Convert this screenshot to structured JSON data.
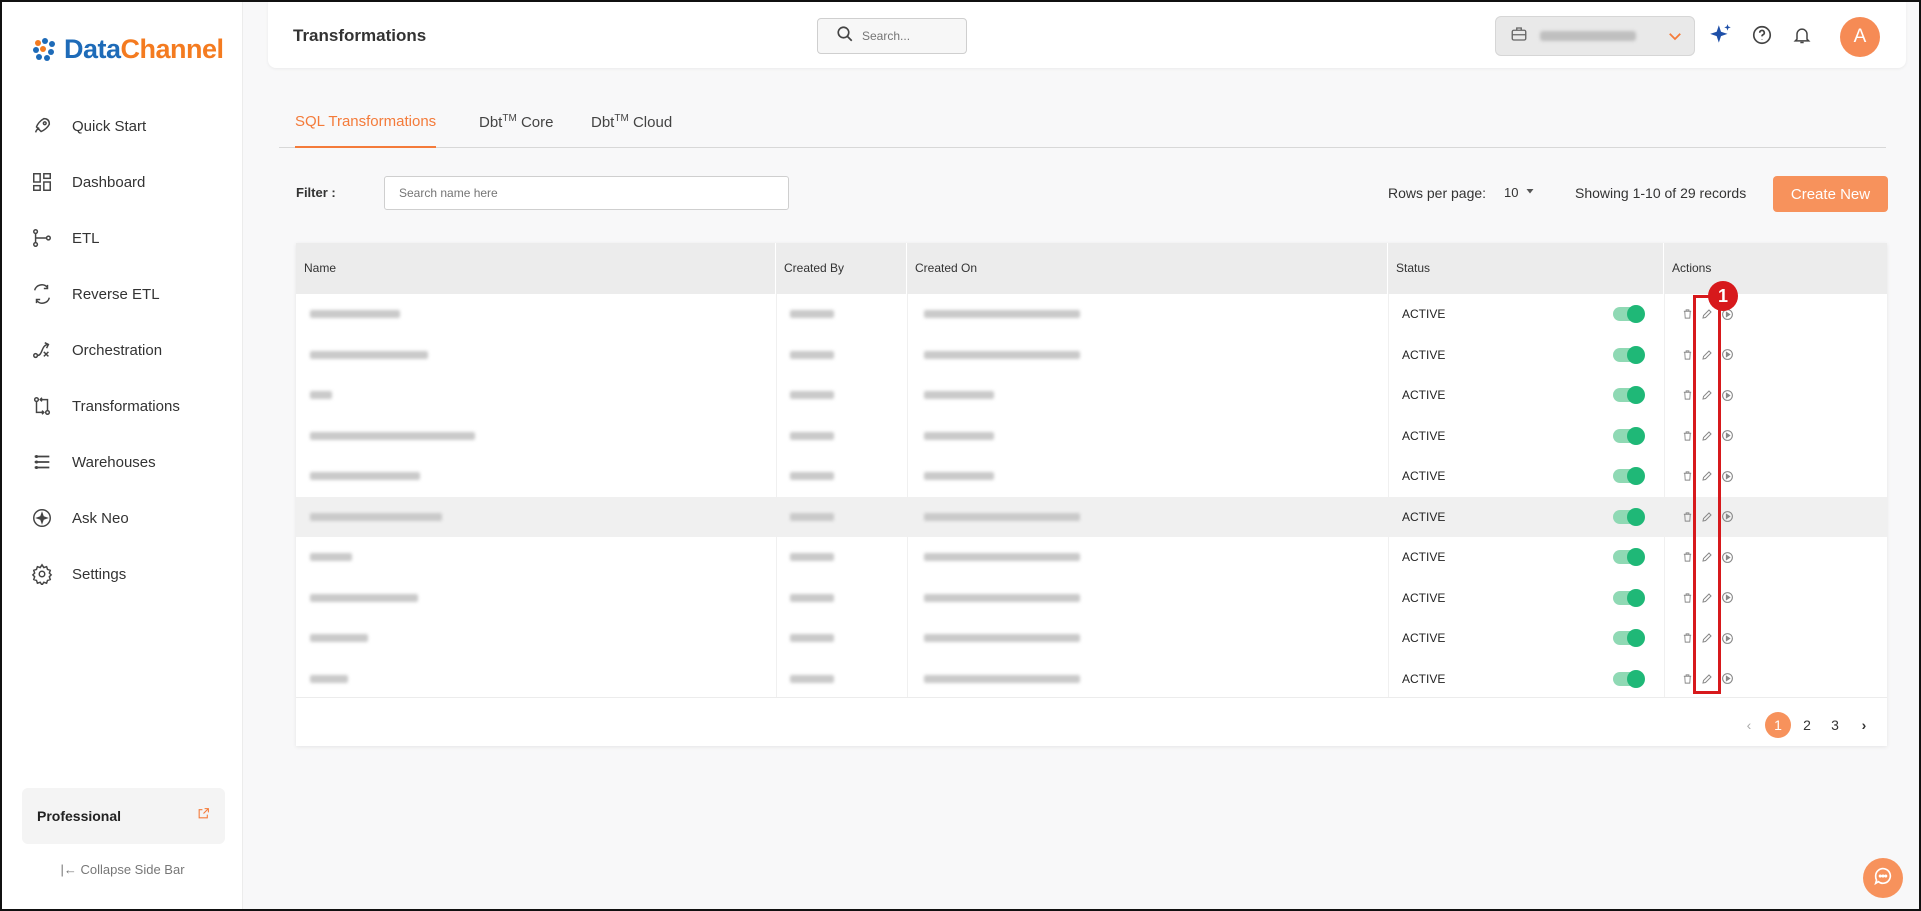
{
  "brand": {
    "name_part1": "Data",
    "name_part2": "Channel",
    "accent": "#f47b20",
    "primary": "#1e6bb8"
  },
  "sidebar": {
    "items": [
      {
        "label": "Quick Start",
        "icon": "rocket-icon"
      },
      {
        "label": "Dashboard",
        "icon": "dashboard-grid-icon"
      },
      {
        "label": "ETL",
        "icon": "etl-flow-icon"
      },
      {
        "label": "Reverse ETL",
        "icon": "reverse-etl-icon"
      },
      {
        "label": "Orchestration",
        "icon": "orchestration-icon"
      },
      {
        "label": "Transformations",
        "icon": "transformations-icon"
      },
      {
        "label": "Warehouses",
        "icon": "warehouses-icon"
      },
      {
        "label": "Ask Neo",
        "icon": "ask-neo-icon"
      },
      {
        "label": "Settings",
        "icon": "gear-icon"
      }
    ],
    "plan": "Professional",
    "collapse_label": "Collapse Side Bar"
  },
  "header": {
    "title": "Transformations",
    "search_placeholder": "Search...",
    "avatar_letter": "A"
  },
  "tabs": [
    {
      "label": "SQL Transformations",
      "sup": "",
      "suffix": ""
    },
    {
      "label": "Dbt",
      "sup": "TM",
      "suffix": " Core"
    },
    {
      "label": "Dbt",
      "sup": "TM",
      "suffix": " Cloud"
    }
  ],
  "filter": {
    "label": "Filter :",
    "placeholder": "Search name here",
    "rows_per_page_label": "Rows per page:",
    "rows_per_page_value": "10",
    "showing": "Showing 1-10 of 29 records",
    "create_label": "Create New"
  },
  "table": {
    "headers": [
      "Name",
      "Created By",
      "Created On",
      "Status",
      "Actions"
    ],
    "rows": [
      {
        "status": "ACTIVE"
      },
      {
        "status": "ACTIVE"
      },
      {
        "status": "ACTIVE"
      },
      {
        "status": "ACTIVE"
      },
      {
        "status": "ACTIVE"
      },
      {
        "status": "ACTIVE"
      },
      {
        "status": "ACTIVE"
      },
      {
        "status": "ACTIVE"
      },
      {
        "status": "ACTIVE"
      },
      {
        "status": "ACTIVE"
      }
    ]
  },
  "pagination": {
    "pages": [
      "1",
      "2",
      "3"
    ],
    "current": "1"
  },
  "annotation": {
    "badge": "1",
    "color": "#d7191c"
  },
  "status_colors": {
    "toggle_on": "#1fb877"
  }
}
